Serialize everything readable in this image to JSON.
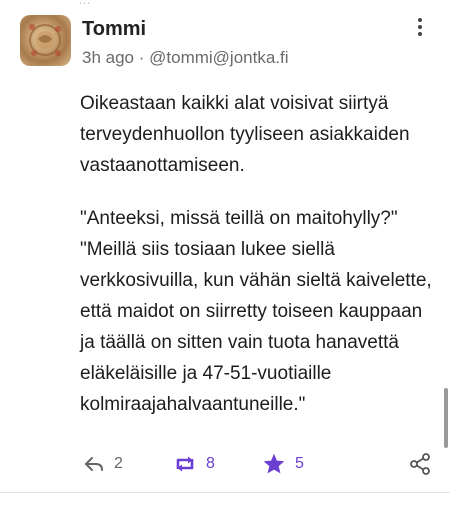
{
  "top_fragment": "…",
  "post": {
    "author_name": "Tommi",
    "timestamp": "3h ago",
    "separator": "·",
    "handle": "@tommi@jontka.fi",
    "paragraph1": "Oikeastaan kaikki alat voisivat siirtyä terveydenhuollon tyyliseen asiakkaiden vastaanottamiseen.",
    "paragraph2_line1": "\"Anteeksi, missä teillä on maitohylly?\"",
    "paragraph2_line2": "\"Meillä siis tosiaan lukee siellä verkkosivuilla, kun vähän sieltä kaivelette, että maidot on siirretty toiseen kauppaan ja täällä on sitten vain tuota hanavettä eläkeläisille ja 47-51-vuotiaille kolmiraajahalvaantuneille.\""
  },
  "actions": {
    "reply_count": "2",
    "boost_count": "8",
    "favourite_count": "5"
  },
  "icons": {
    "avatar": "avatar-image",
    "more": "more-vertical-icon",
    "reply": "reply-icon",
    "boost": "boost-icon",
    "favourite": "star-icon",
    "share": "share-icon"
  },
  "colors": {
    "accent": "#6a3fd1",
    "muted": "#6a6a6a"
  }
}
